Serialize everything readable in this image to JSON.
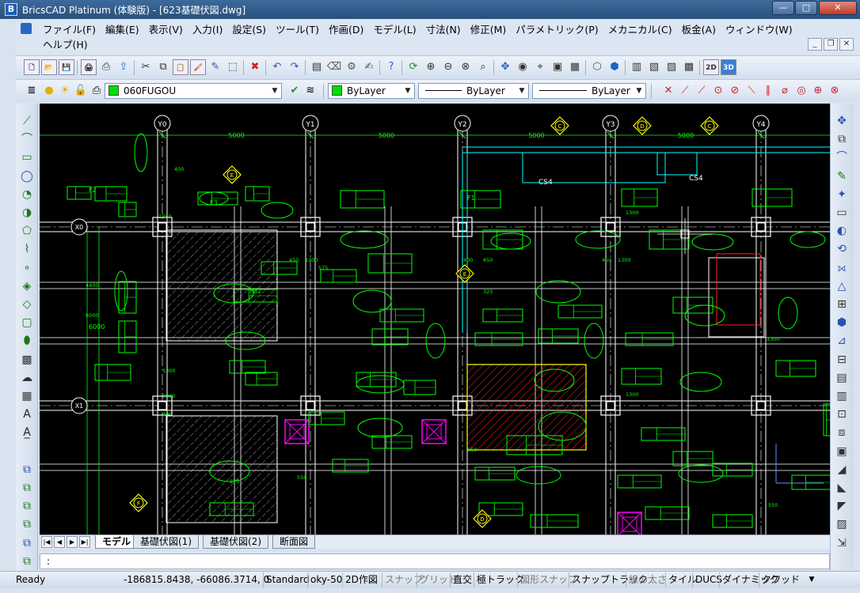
{
  "window": {
    "title": "BricsCAD Platinum (体験版) - [623基礎伏図.dwg]",
    "app_icon_glyph": "B"
  },
  "menu": {
    "items": [
      "ファイル(F)",
      "編集(E)",
      "表示(V)",
      "入力(I)",
      "設定(S)",
      "ツール(T)",
      "作画(D)",
      "モデル(L)",
      "寸法(N)",
      "修正(M)",
      "パラメトリック(P)",
      "メカニカル(C)",
      "板金(A)",
      "ウィンドウ(W)",
      "ヘルプ(H)"
    ]
  },
  "toolbar2": {
    "layer_name": "060FUGOU",
    "color_value": "ByLayer",
    "linetype_value": "ByLayer",
    "lineweight_value": "ByLayer"
  },
  "drawing": {
    "grid_x": [
      "Y0",
      "Y1",
      "Y2",
      "Y3",
      "Y4"
    ],
    "grid_y": [
      "X0",
      "X1"
    ],
    "spans": [
      "5000",
      "5000",
      "5000",
      "5000"
    ],
    "vertical_span": "6000",
    "section_marks": [
      "C",
      "D",
      "C",
      "E",
      "E",
      "F",
      "D"
    ],
    "labels": [
      "CS4",
      "CS4",
      "F1",
      "F2",
      "F3",
      "FB2"
    ],
    "colors": {
      "green": "#00ff00",
      "cyan": "#00ffff",
      "white": "#ffffff",
      "yellow": "#ffff00",
      "red": "#ff2020",
      "magenta": "#ff00ff"
    }
  },
  "tabs": [
    "モデル",
    "基礎伏図(1)",
    "基礎伏図(2)",
    "断面図"
  ],
  "command_prompt": ":",
  "status": {
    "ready": "Ready",
    "coords": "-186815.8438, -66086.3714, 0",
    "items": [
      {
        "label": "Standard",
        "on": true
      },
      {
        "label": "oky-50",
        "on": true
      },
      {
        "label": "2D作図",
        "on": true
      },
      {
        "label": "スナップ",
        "on": false
      },
      {
        "label": "グリッド",
        "on": false
      },
      {
        "label": "直交",
        "on": true
      },
      {
        "label": "極トラック",
        "on": true
      },
      {
        "label": "図形スナップ",
        "on": false
      },
      {
        "label": "スナップトラック",
        "on": true
      },
      {
        "label": "線の太さ",
        "on": false
      },
      {
        "label": "タイル",
        "on": true
      },
      {
        "label": "DUCS",
        "on": true
      },
      {
        "label": "ダイナミック",
        "on": true
      },
      {
        "label": "クワッド",
        "on": true
      }
    ]
  }
}
